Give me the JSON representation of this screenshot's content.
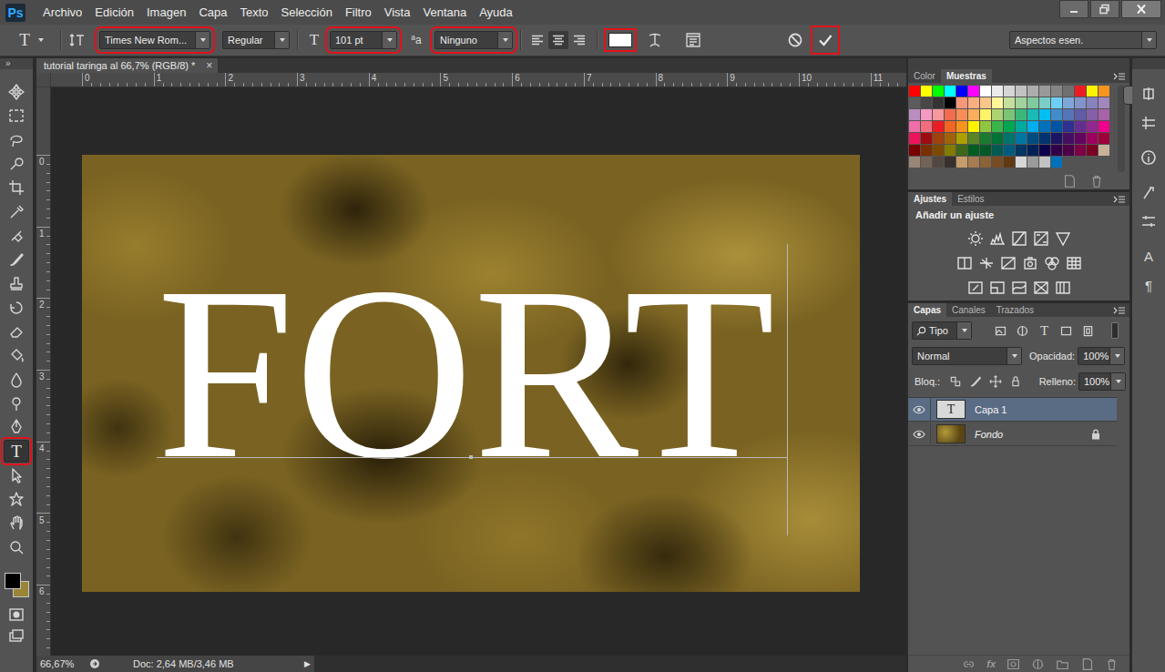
{
  "app": {
    "logo": "Ps"
  },
  "menu": [
    "Archivo",
    "Edición",
    "Imagen",
    "Capa",
    "Texto",
    "Selección",
    "Filtro",
    "Vista",
    "Ventana",
    "Ayuda"
  ],
  "options_bar": {
    "tool_glyph": "T",
    "font_family": {
      "value": "Times New Rom...",
      "highlighted": true
    },
    "font_style": {
      "value": "Regular",
      "highlighted": false
    },
    "size_glyph": "T",
    "font_size": {
      "value": "101 pt",
      "highlighted": true
    },
    "antialias_glyph": "ªa",
    "antialias": {
      "value": "Ninguno",
      "highlighted": true
    },
    "align": [
      {
        "selected": false
      },
      {
        "selected": true
      },
      {
        "selected": false
      }
    ],
    "text_color": {
      "color": "#ffffff",
      "highlighted": true
    },
    "cancel": {
      "highlighted": false
    },
    "commit": {
      "highlighted": true
    }
  },
  "workspace": "Aspectos esen.",
  "toolbar": {
    "collapse": "»",
    "tools": [
      {
        "kind": "icon",
        "selected": false,
        "highlighted": false
      },
      {
        "kind": "icon",
        "selected": false,
        "highlighted": false
      },
      {
        "kind": "icon",
        "selected": false,
        "highlighted": false
      },
      {
        "kind": "icon",
        "selected": false,
        "highlighted": false
      },
      {
        "kind": "icon",
        "selected": false,
        "highlighted": false
      },
      {
        "kind": "icon",
        "selected": false,
        "highlighted": false
      },
      {
        "kind": "icon",
        "selected": false,
        "highlighted": false
      },
      {
        "kind": "icon",
        "selected": false,
        "highlighted": false
      },
      {
        "kind": "icon",
        "selected": false,
        "highlighted": false
      },
      {
        "kind": "icon",
        "selected": false,
        "highlighted": false
      },
      {
        "kind": "icon",
        "selected": false,
        "highlighted": false
      },
      {
        "kind": "icon",
        "selected": false,
        "highlighted": false
      },
      {
        "kind": "icon",
        "selected": false,
        "highlighted": false
      },
      {
        "kind": "icon",
        "selected": false,
        "highlighted": false
      },
      {
        "kind": "icon",
        "selected": false,
        "highlighted": false
      },
      {
        "kind": "glyph",
        "glyph": "T",
        "selected": true,
        "highlighted": true
      },
      {
        "kind": "icon",
        "selected": false,
        "highlighted": false
      },
      {
        "kind": "icon",
        "selected": false,
        "highlighted": false
      },
      {
        "kind": "icon",
        "selected": false,
        "highlighted": false
      },
      {
        "kind": "icon",
        "selected": false,
        "highlighted": false
      }
    ],
    "foreground": "#000000",
    "background": "#9a8436"
  },
  "document": {
    "tab": {
      "title": "tutorial taringa al 66,7% (RGB/8) *",
      "close": "×",
      "selected": true
    },
    "ruler_h": [
      "0",
      "1",
      "2",
      "3",
      "4",
      "5",
      "6",
      "7",
      "8",
      "9",
      "10",
      "11"
    ],
    "ruler_v": [
      "0",
      "1",
      "2",
      "3",
      "4",
      "5",
      "6"
    ],
    "text_layer": {
      "text": "FORT",
      "color": "#ffffff",
      "editing": true
    }
  },
  "status_bar": {
    "zoom": "66,67%",
    "doc_info": "Doc: 2,64 MB/3,46 MB",
    "arrow": "▶"
  },
  "swatches_panel": {
    "tabs": [
      {
        "label": "Color",
        "selected": false
      },
      {
        "label": "Muestras",
        "selected": true
      }
    ],
    "swatches": [
      "#ff0000",
      "#ffff00",
      "#00ff00",
      "#00ffff",
      "#0000ff",
      "#ff00ff",
      "#ffffff",
      "#ebebeb",
      "#d6d6d6",
      "#c2c2c2",
      "#adadad",
      "#999999",
      "#858585",
      "#707070",
      "#ed1c24",
      "#fff200",
      "#f7941d",
      "#5c5c5c",
      "#474747",
      "#333333",
      "#000000",
      "#f7977a",
      "#f9ad81",
      "#fdc68a",
      "#fff79a",
      "#c4df9b",
      "#a3d39c",
      "#82ca9d",
      "#7bcdc8",
      "#6ecff6",
      "#7ea7d8",
      "#8493ca",
      "#8882be",
      "#a187be",
      "#bc8dbf",
      "#f49ac2",
      "#f6989d",
      "#f26c4f",
      "#f68e55",
      "#fbaf5c",
      "#fff467",
      "#acd372",
      "#7cc576",
      "#3bb878",
      "#1abbb4",
      "#00bff3",
      "#438ccb",
      "#5574b9",
      "#605ca8",
      "#855fa8",
      "#a763a8",
      "#f06eaa",
      "#f26d7d",
      "#ed1c24",
      "#f26522",
      "#f7941d",
      "#fff200",
      "#8dc73f",
      "#39b54a",
      "#00a651",
      "#00a99d",
      "#00aeef",
      "#0072bc",
      "#0054a6",
      "#2e3192",
      "#662d91",
      "#92278f",
      "#ec008c",
      "#ed145b",
      "#9e0b0f",
      "#a0410d",
      "#a36209",
      "#aba000",
      "#598527",
      "#1a7b30",
      "#007236",
      "#00746b",
      "#0076a3",
      "#004b80",
      "#003471",
      "#1b1464",
      "#440e62",
      "#630460",
      "#9e005d",
      "#9e0039",
      "#790000",
      "#7b2e00",
      "#7d4900",
      "#827b00",
      "#406618",
      "#005e20",
      "#005826",
      "#005952",
      "#005b7f",
      "#003663",
      "#002157",
      "#0d004c",
      "#32004b",
      "#4b0049",
      "#7b0046",
      "#7a0026",
      "#c7b299",
      "#998675",
      "#736357",
      "#534741",
      "#37302d",
      "#c69c6d",
      "#a67c52",
      "#8c6239",
      "#754c24",
      "#603913",
      "#d6d6d6",
      "#9b9b9b",
      "#c2c2c2",
      "#0072bc"
    ]
  },
  "adjustments_panel": {
    "tabs": [
      {
        "label": "Ajustes",
        "selected": true
      },
      {
        "label": "Estilos",
        "selected": false
      }
    ],
    "title": "Añadir un ajuste"
  },
  "layers_panel": {
    "tabs": [
      {
        "label": "Capas",
        "selected": true
      },
      {
        "label": "Canales",
        "selected": false
      },
      {
        "label": "Trazados",
        "selected": false
      }
    ],
    "filter": "Tipo",
    "filters": [
      {
        "kind": "icon"
      },
      {
        "kind": "icon"
      },
      {
        "kind": "glyph",
        "glyph": "T"
      },
      {
        "kind": "icon"
      },
      {
        "kind": "icon"
      }
    ],
    "blend_mode": "Normal",
    "opacity_label": "Opacidad:",
    "opacity": "100%",
    "lock_label": "Bloq.:",
    "fill_label": "Relleno:",
    "fill": "100%",
    "layers": [
      {
        "name": "Capa 1",
        "kind": "text",
        "thumb_glyph": "T",
        "visible": true,
        "selected": true,
        "locked": false
      },
      {
        "name": "Fondo",
        "kind": "background",
        "thumb_glyph": "",
        "visible": true,
        "selected": false,
        "locked": true
      }
    ],
    "footer_fx": "fx"
  },
  "side_strip": [
    {
      "kind": "icon",
      "glyph": ""
    },
    {
      "kind": "icon",
      "glyph": ""
    },
    {
      "kind": "icon",
      "glyph": ""
    },
    {
      "kind": "icon",
      "glyph": ""
    },
    {
      "kind": "icon",
      "glyph": ""
    },
    {
      "kind": "glyph",
      "glyph": "A"
    },
    {
      "kind": "glyph",
      "glyph": "¶"
    }
  ]
}
